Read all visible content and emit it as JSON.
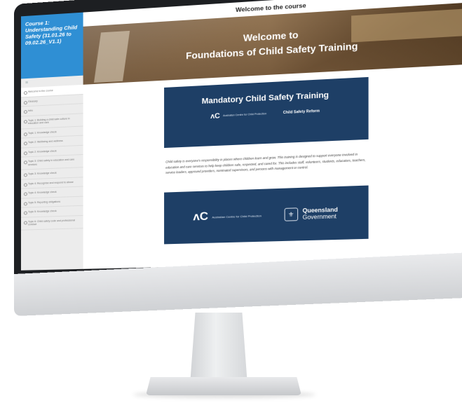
{
  "sidebar": {
    "course_title": "Course 1: Understanding Child Safety (31.01.26 to 09.02.26_V1.1)",
    "menu_icon": "≡",
    "items": [
      "Welcome to the course",
      "Glossary",
      "Intro",
      "Topic 1: Building a child safe culture in education and care",
      "Topic 1: Knowledge check",
      "Topic 2: Wellbeing and wellness",
      "Topic 2: Knowledge check",
      "Topic 3: Child safety in education and care services",
      "Topic 3: Knowledge check",
      "Topic 4: Recognise and respond to abuse",
      "Topic 4: Knowledge check",
      "Topic 5: Reporting obligations",
      "Topic 5: Knowledge check",
      "Topic 6: Child safety code and professional conduct"
    ]
  },
  "header": {
    "title": "Welcome to the course"
  },
  "hero": {
    "line1": "Welcome to",
    "line2": "Foundations of Child Safety Training"
  },
  "banner1": {
    "title": "Mandatory Child Safety Training",
    "logo_symbol": "ᴧC",
    "logo_text": "Australian Centre for Child Protection",
    "logo2_text": "Child Safety Reform"
  },
  "body_text": "Child safety is everyone's responsibility in places where children learn and grow. This training is designed to support everyone involved in education and care services to help keep children safe, respected, and cared for. This includes staff, volunteers, students, educators, teachers, service leaders, approved providers, nominated supervisors, and persons with management or control.",
  "banner2": {
    "logo_symbol": "ᴧC",
    "logo_text": "Australian Centre for Child Protection",
    "qld_line1": "Queensland",
    "qld_line2": "Government"
  }
}
